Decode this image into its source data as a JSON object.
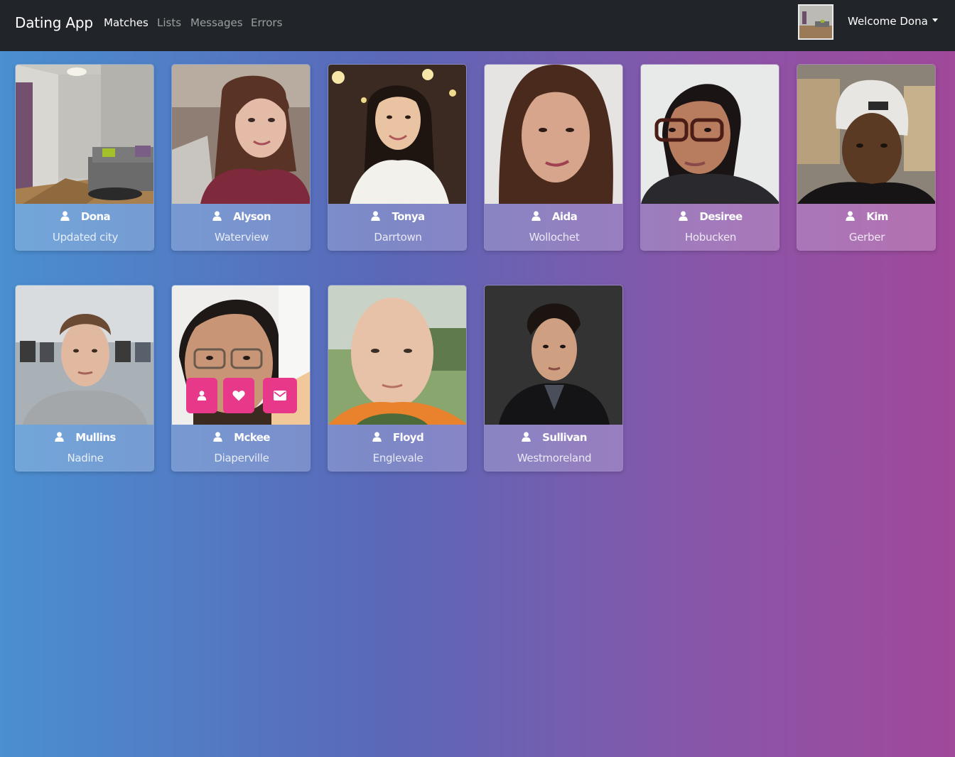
{
  "navbar": {
    "brand": "Dating App",
    "links": [
      {
        "label": "Matches",
        "active": true
      },
      {
        "label": "Lists",
        "active": false
      },
      {
        "label": "Messages",
        "active": false
      },
      {
        "label": "Errors",
        "active": false
      }
    ],
    "welcome": "Welcome Dona",
    "avatar_icon": "user-avatar-photo"
  },
  "members": [
    {
      "name": "Dona",
      "city": "Updated city",
      "photo": "living-room-interior"
    },
    {
      "name": "Alyson",
      "city": "Waterview",
      "photo": "woman-portrait"
    },
    {
      "name": "Tonya",
      "city": "Darrtown",
      "photo": "woman-portrait"
    },
    {
      "name": "Aida",
      "city": "Wollochet",
      "photo": "woman-portrait"
    },
    {
      "name": "Desiree",
      "city": "Hobucken",
      "photo": "woman-portrait"
    },
    {
      "name": "Kim",
      "city": "Gerber",
      "photo": "man-portrait"
    },
    {
      "name": "Mullins",
      "city": "Nadine",
      "photo": "man-portrait"
    },
    {
      "name": "Mckee",
      "city": "Diaperville",
      "photo": "man-portrait"
    },
    {
      "name": "Floyd",
      "city": "Englevale",
      "photo": "man-portrait"
    },
    {
      "name": "Sullivan",
      "city": "Westmoreland",
      "photo": "man-portrait"
    }
  ],
  "hover_actions": [
    {
      "icon": "user-icon"
    },
    {
      "icon": "heart-icon"
    },
    {
      "icon": "envelope-icon"
    }
  ],
  "colors": {
    "navbar_bg": "#212529",
    "action_pink": "#e8388a",
    "gradient_start": "#4a8fd0",
    "gradient_end": "#a0489a"
  }
}
